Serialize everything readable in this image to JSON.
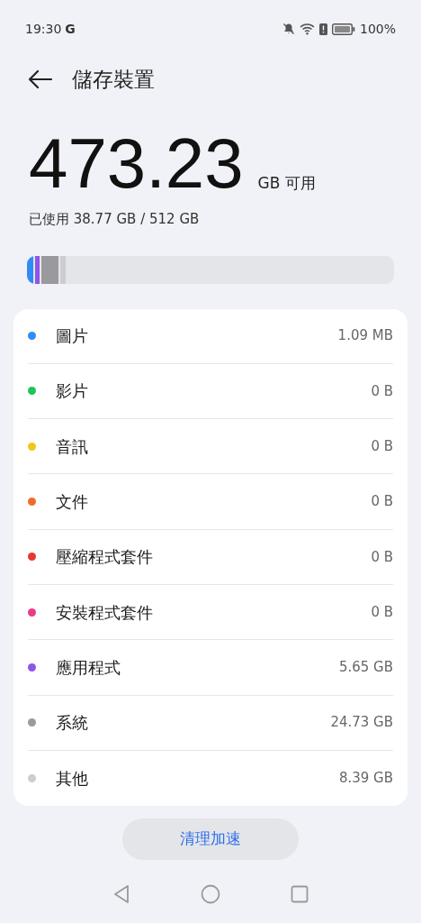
{
  "status_bar": {
    "time": "19:30",
    "notification": "G",
    "battery": "100%"
  },
  "header": {
    "title": "儲存裝置"
  },
  "summary": {
    "available": "473.23",
    "available_unit": "GB 可用",
    "used": "已使用 38.77 GB / 512 GB"
  },
  "storage_bar": {
    "segments": [
      {
        "color": "#2f8cf6",
        "level": 0.016
      },
      {
        "color": "#8f55e8",
        "level": 0.013
      },
      {
        "color": "#9a9a9e",
        "level": 0.048
      },
      {
        "color": "#cdcdd0"
      }
    ]
  },
  "categories": [
    {
      "name": "圖片",
      "size": "1.09 MB",
      "color": "#2f8cf6"
    },
    {
      "name": "影片",
      "size": "0 B",
      "color": "#1fc45a"
    },
    {
      "name": "音訊",
      "size": "0 B",
      "color": "#f5c518"
    },
    {
      "name": "文件",
      "size": "0 B",
      "color": "#f26b2c"
    },
    {
      "name": "壓縮程式套件",
      "size": "0 B",
      "color": "#e8392f"
    },
    {
      "name": "安裝程式套件",
      "size": "0 B",
      "color": "#ec3b85"
    },
    {
      "name": "應用程式",
      "size": "5.65 GB",
      "color": "#8f55e8"
    },
    {
      "name": "系統",
      "size": "24.73 GB",
      "color": "#9a9a9e"
    },
    {
      "name": "其他",
      "size": "8.39 GB",
      "color": "#cdcdd0"
    }
  ],
  "clean_button": "清理加速"
}
